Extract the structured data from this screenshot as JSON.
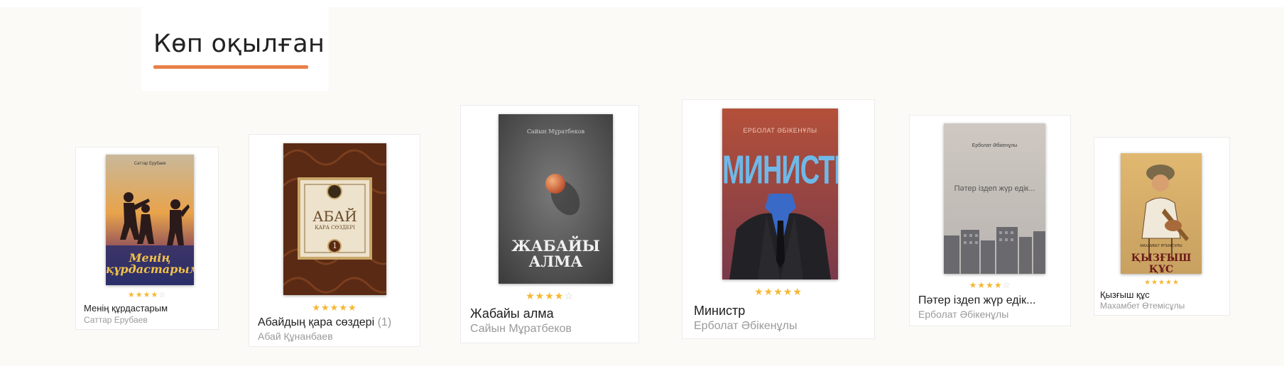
{
  "section": {
    "title": "Көп оқылған"
  },
  "colors": {
    "accent": "#e8804a",
    "star": "#f5b731",
    "star_empty": "#cfcfcf"
  },
  "books": [
    {
      "title": "Менің құрдастарым",
      "author": "Саттар Ерубаев",
      "rating": 4,
      "cover": {
        "author": "Саттар Ерубаев",
        "title_line1": "Менің",
        "title_line2": "құрдастарым"
      }
    },
    {
      "title": "Абайдың қара сөздері",
      "reviews": "(1)",
      "author": "Абай Құнанбаев",
      "rating": 5,
      "cover": {
        "title_line1": "АБАЙ",
        "title_line2": "ҚАРА СӨЗДЕРІ",
        "volume": "1"
      }
    },
    {
      "title": "Жабайы алма",
      "author": "Сайын Мұратбеков",
      "rating": 4,
      "cover": {
        "author": "Сайын Мұратбеков",
        "title_line1": "ЖАБАЙЫ",
        "title_line2": "АЛМА"
      }
    },
    {
      "title": "Министр",
      "author": "Ерболат Әбікенұлы",
      "rating": 5,
      "cover": {
        "author": "ЕРБОЛАТ ӘБІКЕНҰЛЫ",
        "title_line1": "МИНИСТР"
      }
    },
    {
      "title": "Пәтер іздеп жүр едік...",
      "author": "Ерболат Әбікенұлы",
      "rating": 4,
      "cover": {
        "author": "Ерболат Әбікенұлы",
        "title_line1": "Пәтер іздеп жүр едік..."
      }
    },
    {
      "title": "Қызғыш құс",
      "author": "Махамбет Өтемісұлы",
      "rating": 5,
      "cover": {
        "author": "МАХАМБЕТ ӨТЕМІСҰЛЫ",
        "title_line1": "ҚЫЗҒЫШ ҚҰС"
      }
    }
  ]
}
